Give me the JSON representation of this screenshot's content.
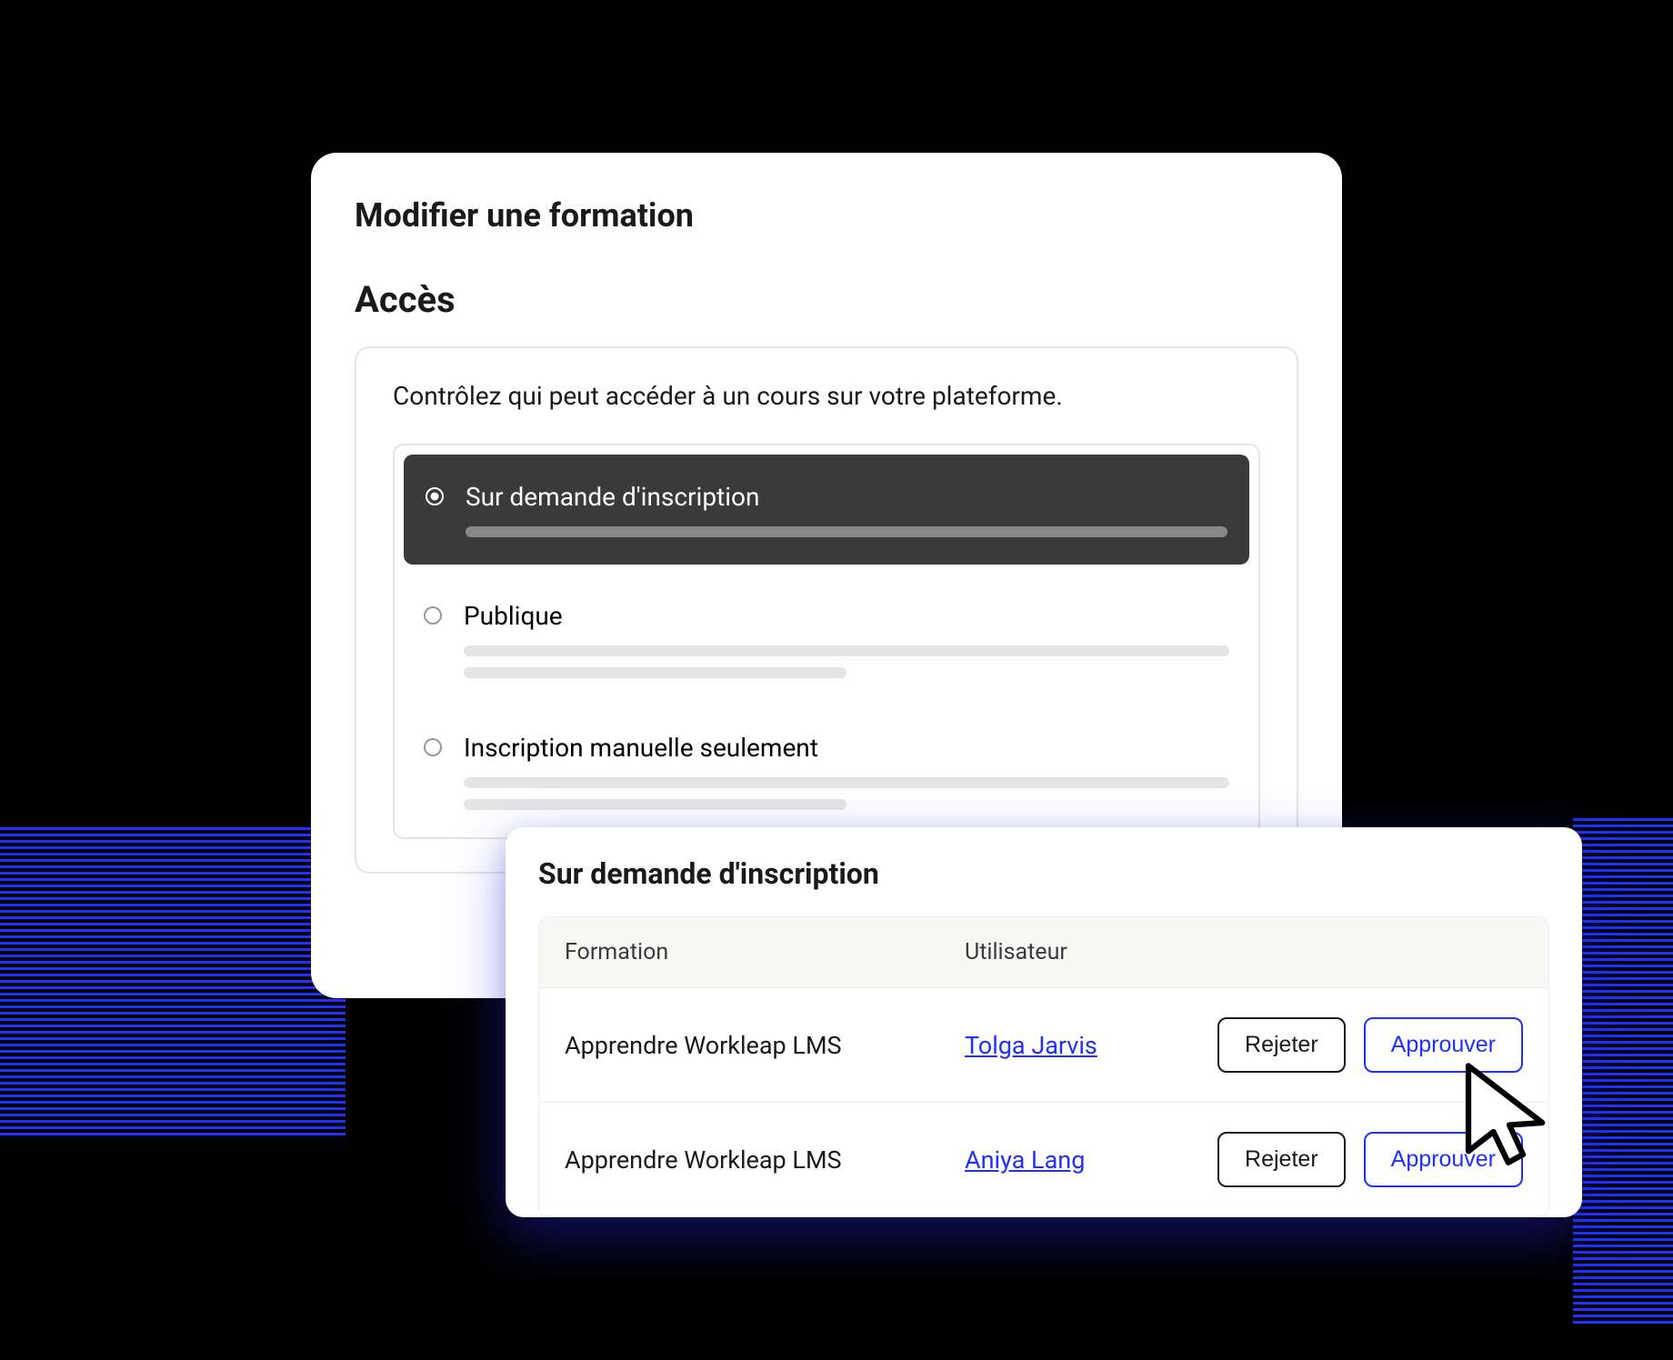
{
  "page": {
    "title": "Modifier une formation",
    "section_title": "Accès",
    "access_description": "Contrôlez qui peut accéder à un cours sur votre plateforme."
  },
  "access_options": [
    {
      "label": "Sur demande d'inscription",
      "selected": true
    },
    {
      "label": "Publique",
      "selected": false
    },
    {
      "label": "Inscription manuelle seulement",
      "selected": false
    }
  ],
  "overlay": {
    "title": "Sur demande d'inscription",
    "columns": {
      "formation": "Formation",
      "user": "Utilisateur"
    },
    "actions": {
      "reject": "Rejeter",
      "approve": "Approuver"
    },
    "requests": [
      {
        "formation": "Apprendre Workleap LMS",
        "user": "Tolga Jarvis"
      },
      {
        "formation": "Apprendre Workleap LMS",
        "user": "Aniya Lang"
      }
    ]
  }
}
